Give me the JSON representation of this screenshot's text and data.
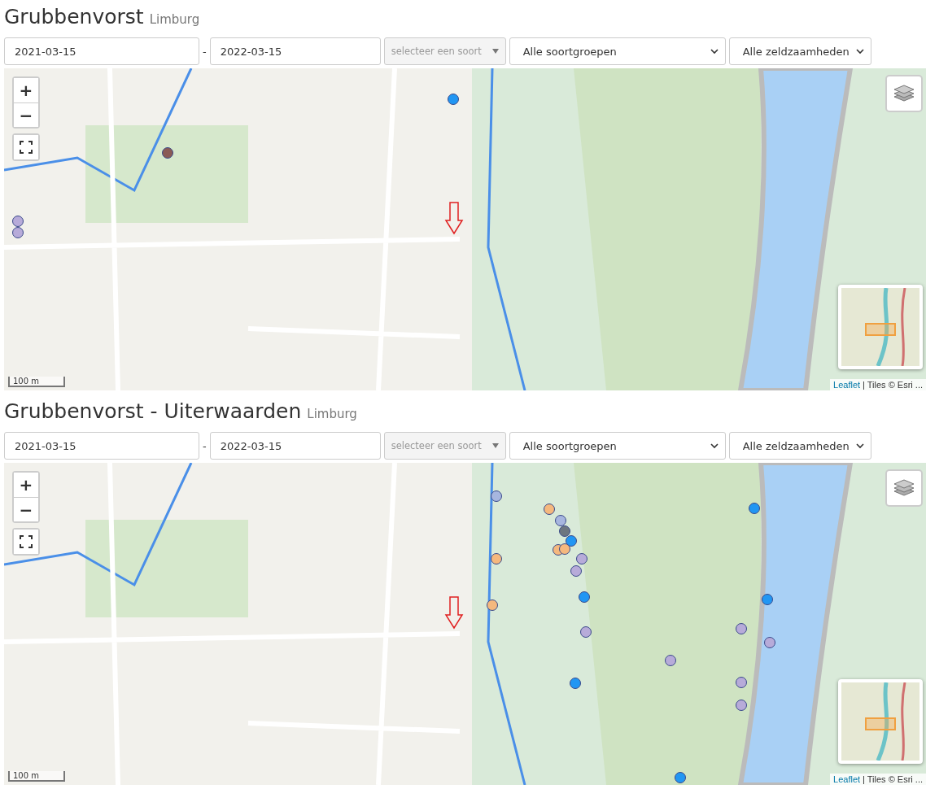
{
  "sections": [
    {
      "title": "Grubbenvorst",
      "province": "Limburg",
      "date_from": "2021-03-15",
      "date_separator": "-",
      "date_to": "2022-03-15",
      "species_select": {
        "placeholder": "selecteer een soort"
      },
      "group_select": "Alle soortgroepen",
      "rarity_select": "Alle zeldzaamheden",
      "map": {
        "zoom_in": "+",
        "zoom_out": "−",
        "scale": "100 m",
        "attribution_link": "Leaflet",
        "attribution_text": "| Tiles © Esri ...",
        "markers": [
          {
            "color": "#2196f3"
          },
          {
            "color": "#8a5a55"
          },
          {
            "color": "#b7abd9"
          },
          {
            "color": "#b7abd9"
          }
        ]
      }
    },
    {
      "title": "Grubbenvorst - Uiterwaarden",
      "province": "Limburg",
      "date_from": "2021-03-15",
      "date_separator": "-",
      "date_to": "2022-03-15",
      "species_select": {
        "placeholder": "selecteer een soort"
      },
      "group_select": "Alle soortgroepen",
      "rarity_select": "Alle zeldzaamheden",
      "map": {
        "zoom_in": "+",
        "zoom_out": "−",
        "scale": "100 m",
        "attribution_link": "Leaflet",
        "attribution_text": "| Tiles © Esri ...",
        "markers": [
          {
            "color": "#a7b6df"
          },
          {
            "color": "#f5b87e"
          },
          {
            "color": "#a7b6df"
          },
          {
            "color": "#6d7680"
          },
          {
            "color": "#2196f3"
          },
          {
            "color": "#f5b87e"
          },
          {
            "color": "#f5b87e"
          },
          {
            "color": "#b7abd9"
          },
          {
            "color": "#b7abd9"
          },
          {
            "color": "#f5b87e"
          },
          {
            "color": "#2196f3"
          },
          {
            "color": "#f5b87e"
          },
          {
            "color": "#b7abd9"
          },
          {
            "color": "#2196f3"
          },
          {
            "color": "#2196f3"
          },
          {
            "color": "#b7abd9"
          },
          {
            "color": "#b7abd9"
          },
          {
            "color": "#b7abd9"
          },
          {
            "color": "#2196f3"
          },
          {
            "color": "#b7abd9"
          },
          {
            "color": "#b7abd9"
          },
          {
            "color": "#2196f3"
          }
        ]
      }
    }
  ]
}
